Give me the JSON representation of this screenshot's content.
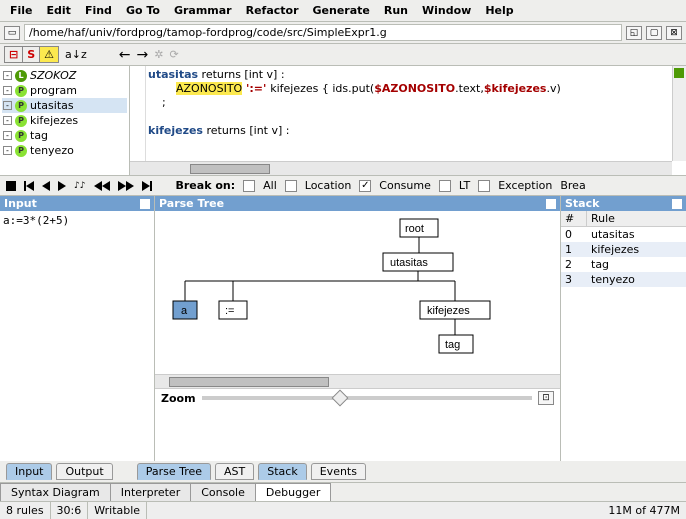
{
  "menu": [
    "File",
    "Edit",
    "Find",
    "Go To",
    "Grammar",
    "Refactor",
    "Generate",
    "Run",
    "Window",
    "Help"
  ],
  "filepath": "/home/haf/univ/fordprog/tamop-fordprog/code/src/SimpleExpr1.g",
  "tree_items": [
    {
      "toggle": "-",
      "badge": "L",
      "label": "SZOKOZ",
      "sel": false
    },
    {
      "toggle": "-",
      "badge": "P",
      "label": "program",
      "sel": false
    },
    {
      "toggle": "-",
      "badge": "P",
      "label": "utasitas",
      "sel": true
    },
    {
      "toggle": "-",
      "badge": "P",
      "label": "kifejezes",
      "sel": false
    },
    {
      "toggle": "-",
      "badge": "P",
      "label": "tag",
      "sel": false
    },
    {
      "toggle": "-",
      "badge": "P",
      "label": "tenyezo",
      "sel": false
    }
  ],
  "code": {
    "l1a": "utasitas",
    "l1b": " returns [int v] :",
    "l2a": "        ",
    "l2b": "AZONOSITO",
    "l2c": " ':=' ",
    "l2d": "kifejezes { ids.put(",
    "l2e": "$AZONOSITO",
    "l2f": ".text,",
    "l2g": "$kifejezes",
    "l2h": ".v)",
    "l3": "    ;",
    "l4": "",
    "l5a": "kifejezes",
    "l5b": " returns [int v] :"
  },
  "break_label": "Break on:",
  "breaks": [
    {
      "label": "All",
      "on": false
    },
    {
      "label": "Location",
      "on": false
    },
    {
      "label": "Consume",
      "on": true
    },
    {
      "label": "LT",
      "on": false
    },
    {
      "label": "Exception",
      "on": false
    },
    {
      "label": "Brea",
      "on": false
    }
  ],
  "panels": {
    "input": "Input",
    "parse": "Parse Tree",
    "stack": "Stack"
  },
  "input_text": "a:=3*(2+5)",
  "stack_cols": {
    "num": "#",
    "rule": "Rule"
  },
  "stack_rows": [
    {
      "n": "0",
      "r": "utasitas"
    },
    {
      "n": "1",
      "r": "kifejezes"
    },
    {
      "n": "2",
      "r": "tag"
    },
    {
      "n": "3",
      "r": "tenyezo"
    }
  ],
  "nodes": {
    "root": "root",
    "uta": "utasitas",
    "a": "a",
    "asg": ":=",
    "kif": "kifejezes",
    "tag": "tag"
  },
  "zoom_label": "Zoom",
  "view_tabs_l": [
    "Input",
    "Output"
  ],
  "view_tabs_r": [
    "Parse Tree",
    "AST",
    "Stack",
    "Events"
  ],
  "bottom_tabs": [
    "Syntax Diagram",
    "Interpreter",
    "Console",
    "Debugger"
  ],
  "status": {
    "rules": "8 rules",
    "pos": "30:6",
    "mode": "Writable",
    "mem": "11M of 477M"
  }
}
